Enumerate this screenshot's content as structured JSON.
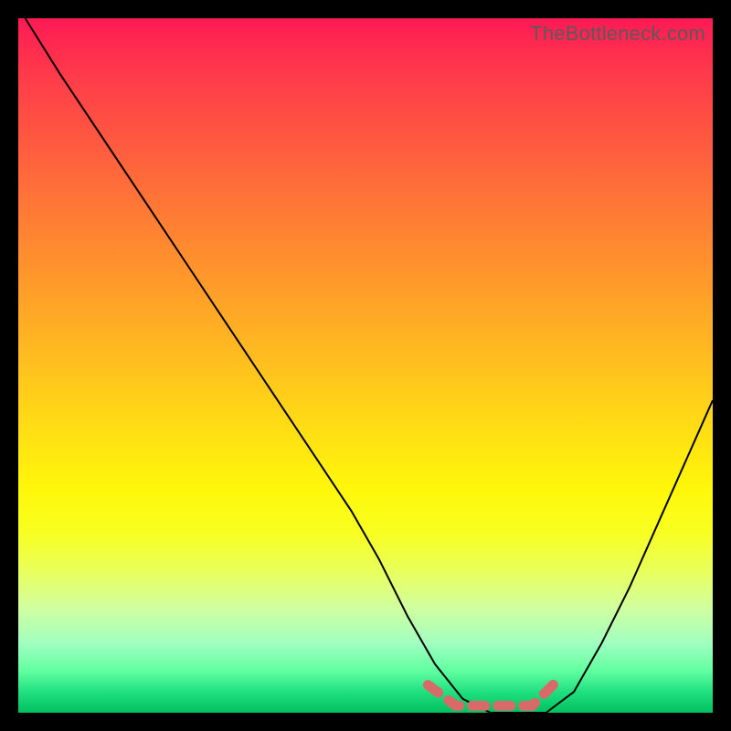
{
  "watermark": "TheBottleneck.com",
  "colors": {
    "frame": "#000000",
    "gradient_top": "#ff1a55",
    "gradient_bottom": "#00c060",
    "curve": "#000000",
    "marker": "#d86a6a"
  },
  "chart_data": {
    "type": "line",
    "title": "",
    "xlabel": "",
    "ylabel": "",
    "xlim": [
      0,
      100
    ],
    "ylim": [
      0,
      100
    ],
    "x": [
      1,
      6,
      12,
      18,
      24,
      30,
      36,
      42,
      48,
      52,
      56,
      60,
      64,
      68,
      72,
      76,
      80,
      84,
      88,
      92,
      96,
      100
    ],
    "values": [
      100,
      92,
      83,
      74,
      65,
      56,
      47,
      38,
      29,
      22,
      14,
      7,
      2,
      0,
      0,
      0,
      3,
      10,
      18,
      27,
      36,
      45
    ],
    "flat_region": {
      "x_start": 59,
      "x_end": 78,
      "y": 1
    },
    "notes": "Axes are unlabeled in the source image; values are estimated from pixel positions on a 0–100 normalized scale. Background is a vertical red→green heat gradient."
  }
}
